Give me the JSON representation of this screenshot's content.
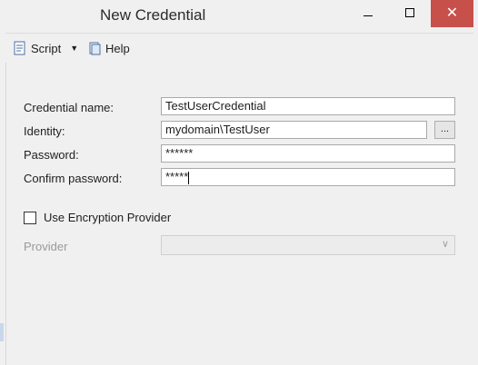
{
  "window": {
    "title": "New Credential",
    "minimize_glyph": "",
    "close_glyph": "✕"
  },
  "toolbar": {
    "script_label": "Script",
    "help_label": "Help",
    "dropdown_glyph": "▼"
  },
  "form": {
    "credential_name_label": "Credential name:",
    "credential_name_value": "TestUserCredential",
    "identity_label": "Identity:",
    "identity_value": "mydomain\\TestUser",
    "browse_label": "...",
    "password_label": "Password:",
    "password_value": "******",
    "confirm_label": "Confirm password:",
    "confirm_value": "*****",
    "use_encryption_label": "Use Encryption Provider",
    "use_encryption_checked": false,
    "provider_label": "Provider",
    "provider_value": ""
  },
  "icons": {
    "script": "script-icon",
    "help": "help-icon",
    "dropdown": "chevron-down-icon"
  },
  "colors": {
    "close_button": "#c7504b",
    "background": "#f0f0f0"
  }
}
